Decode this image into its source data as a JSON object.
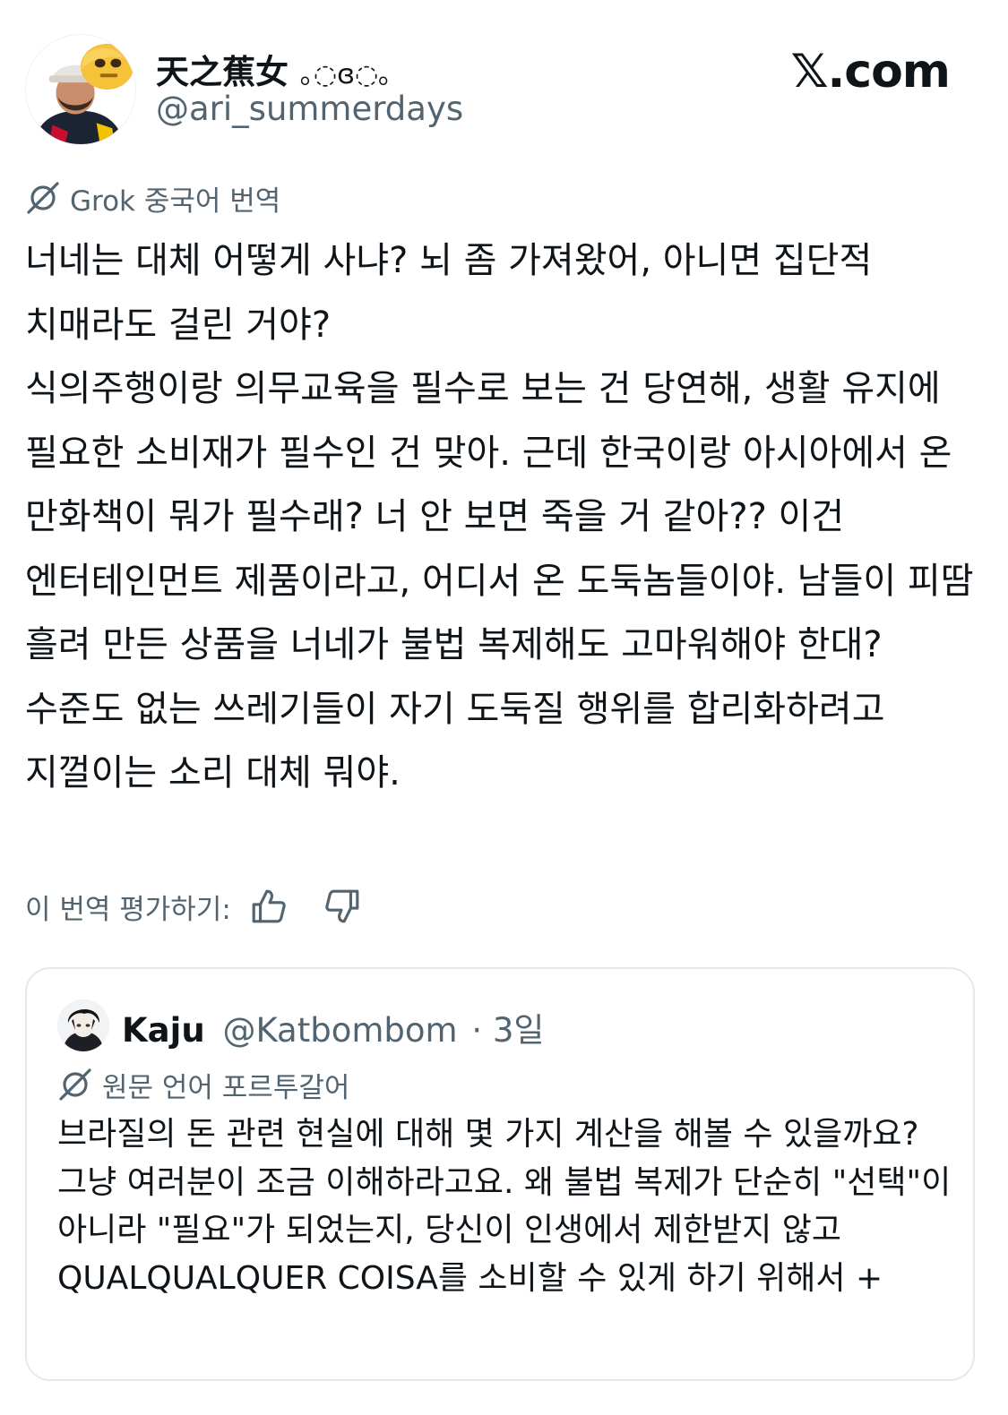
{
  "post": {
    "author_name": "天之蕉女",
    "author_kaomoji": "｡◌ɞ◌｡",
    "author_handle": "@ari_summerdays",
    "site_label": "𝕏.com",
    "translation_label": "Grok 중국어 번역",
    "paragraphs": [
      "너네는 대체 어떻게 사냐? 뇌 좀 가져왔어, 아니면 집단적 치매라도 걸린 거야?",
      "식의주행이랑 의무교육을 필수로 보는 건 당연해, 생활 유지에 필요한 소비재가 필수인 건 맞아. 근데 한국이랑 아시아에서 온 만화책이 뭐가 필수래? 너 안 보면 죽을 거 같아?? 이건 엔터테인먼트 제품이라고, 어디서 온 도둑놈들이야. 남들이 피땀 흘려 만든 상품을 너네가 불법 복제해도 고마워해야 한대?",
      "수준도 없는 쓰레기들이 자기 도둑질 행위를 합리화하려고 지껄이는 소리 대체 뭐야."
    ],
    "rate_label": "이 번역 평가하기:"
  },
  "quote": {
    "author_name": "Kaju",
    "author_handle": "@Katbombom",
    "time": "· 3일",
    "translation_label": "원문 언어 포르투갈어",
    "text": "브라질의 돈 관련 현실에 대해 몇 가지 계산을 해볼 수 있을까요? 그냥 여러분이 조금 이해하라고요. 왜 불법 복제가 단순히 \"선택\"이 아니라 \"필요\"가 되었는지, 당신이 인생에서 제한받지 않고 QUALQUALQUER COISA를 소비할 수 있게 하기 위해서 +"
  },
  "icons": {
    "grok": "grok-slash-icon",
    "thumbs_up": "thumbs-up-icon",
    "thumbs_down": "thumbs-down-icon"
  },
  "colors": {
    "text": "#0f1419",
    "secondary": "#536471",
    "border": "#e6e9ec"
  }
}
